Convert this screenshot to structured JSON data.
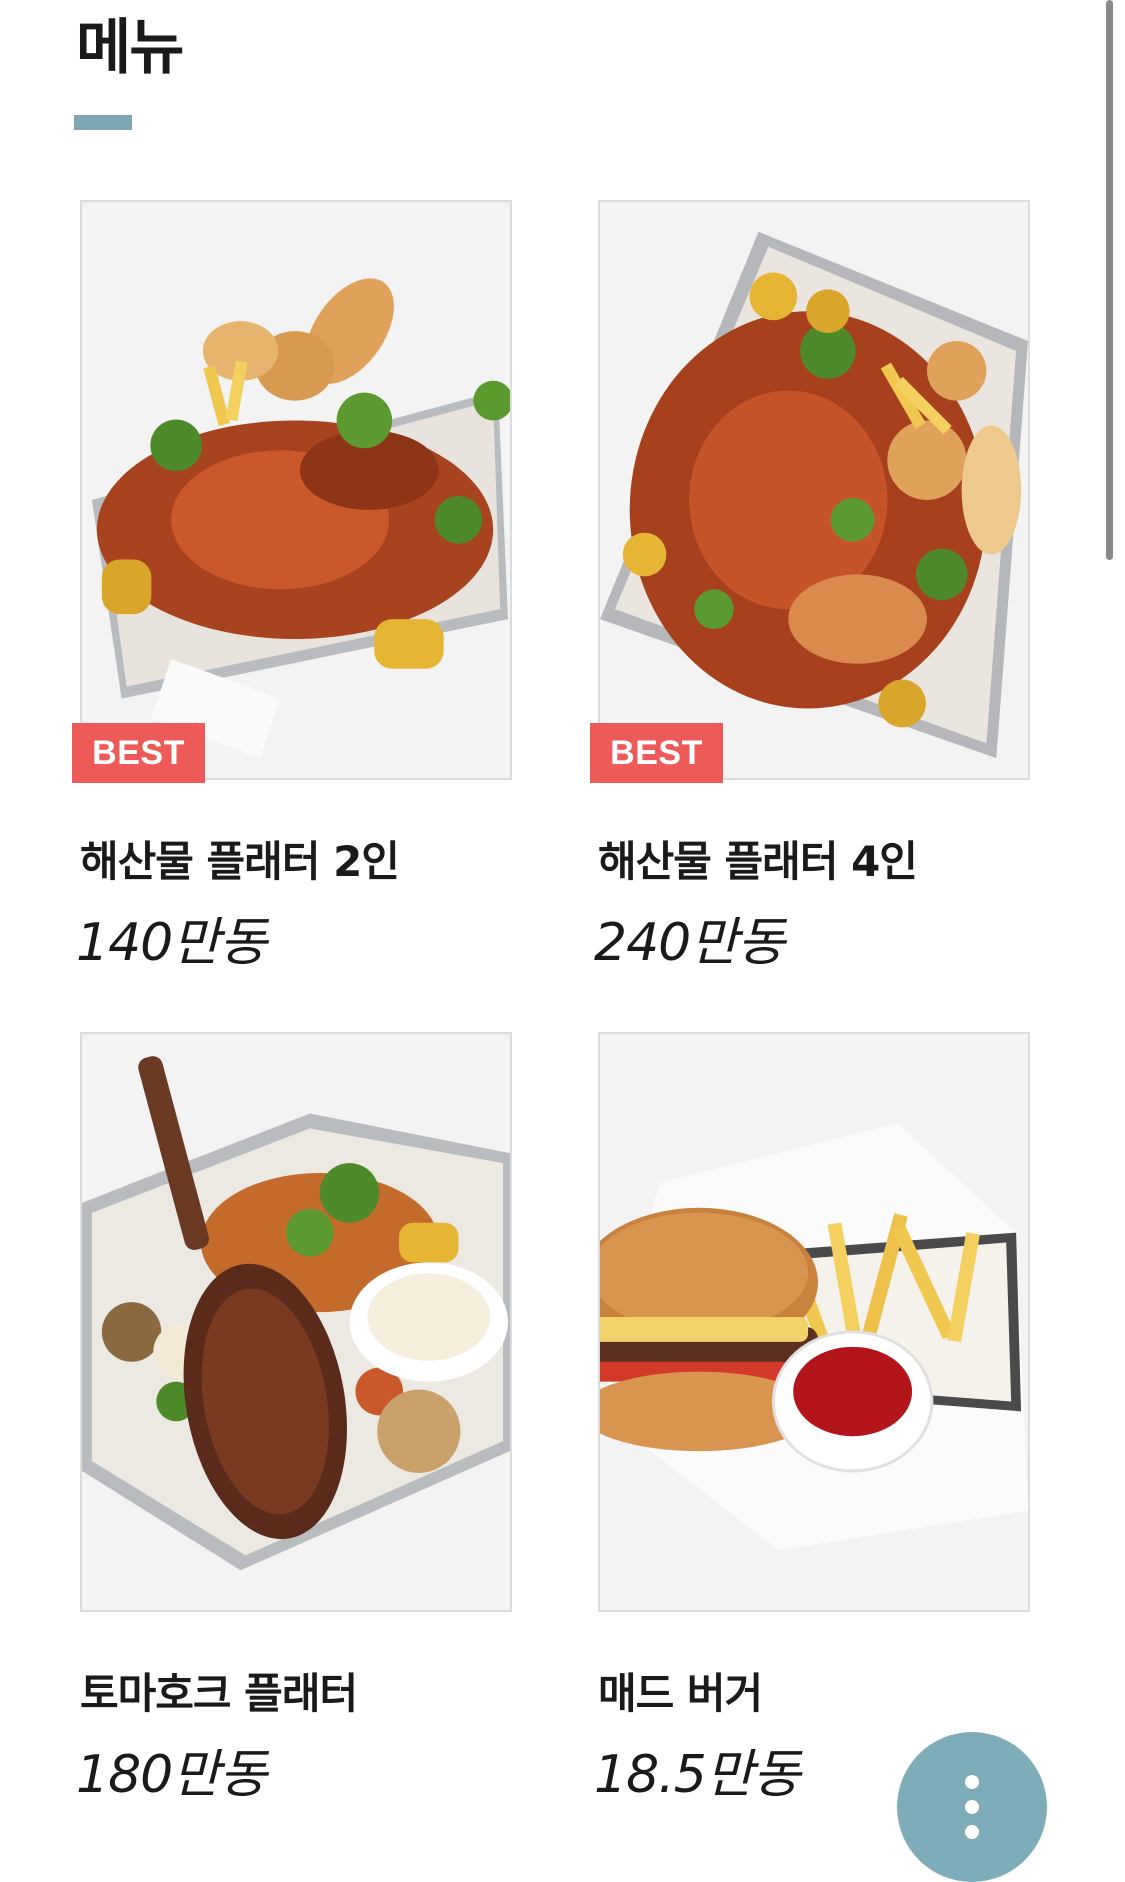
{
  "header": {
    "title": "메뉴",
    "accent_color": "#7ea7b3"
  },
  "menu": {
    "items": [
      {
        "name": "해산물 플래터 2인",
        "price": "140만동",
        "badge": "BEST",
        "image_subject": "seafood platter with crab, corn, bread and fries in a metal tray"
      },
      {
        "name": "해산물 플래터 4인",
        "price": "240만동",
        "badge": "BEST",
        "image_subject": "large seafood platter with crab, clams, corn, bread and fries in a metal tray"
      },
      {
        "name": "토마호크 플래터",
        "price": "180만동",
        "badge": "",
        "image_subject": "tomahawk steak with grilled vegetables and dipping sauce"
      },
      {
        "name": "매드 버거",
        "price": "18.5만동",
        "badge": "",
        "image_subject": "burger with fries and ketchup cup in a basket"
      }
    ]
  },
  "fab": {
    "icon": "more-vertical-icon",
    "color": "#7eacb8"
  },
  "badge_color": "#ee5a57"
}
